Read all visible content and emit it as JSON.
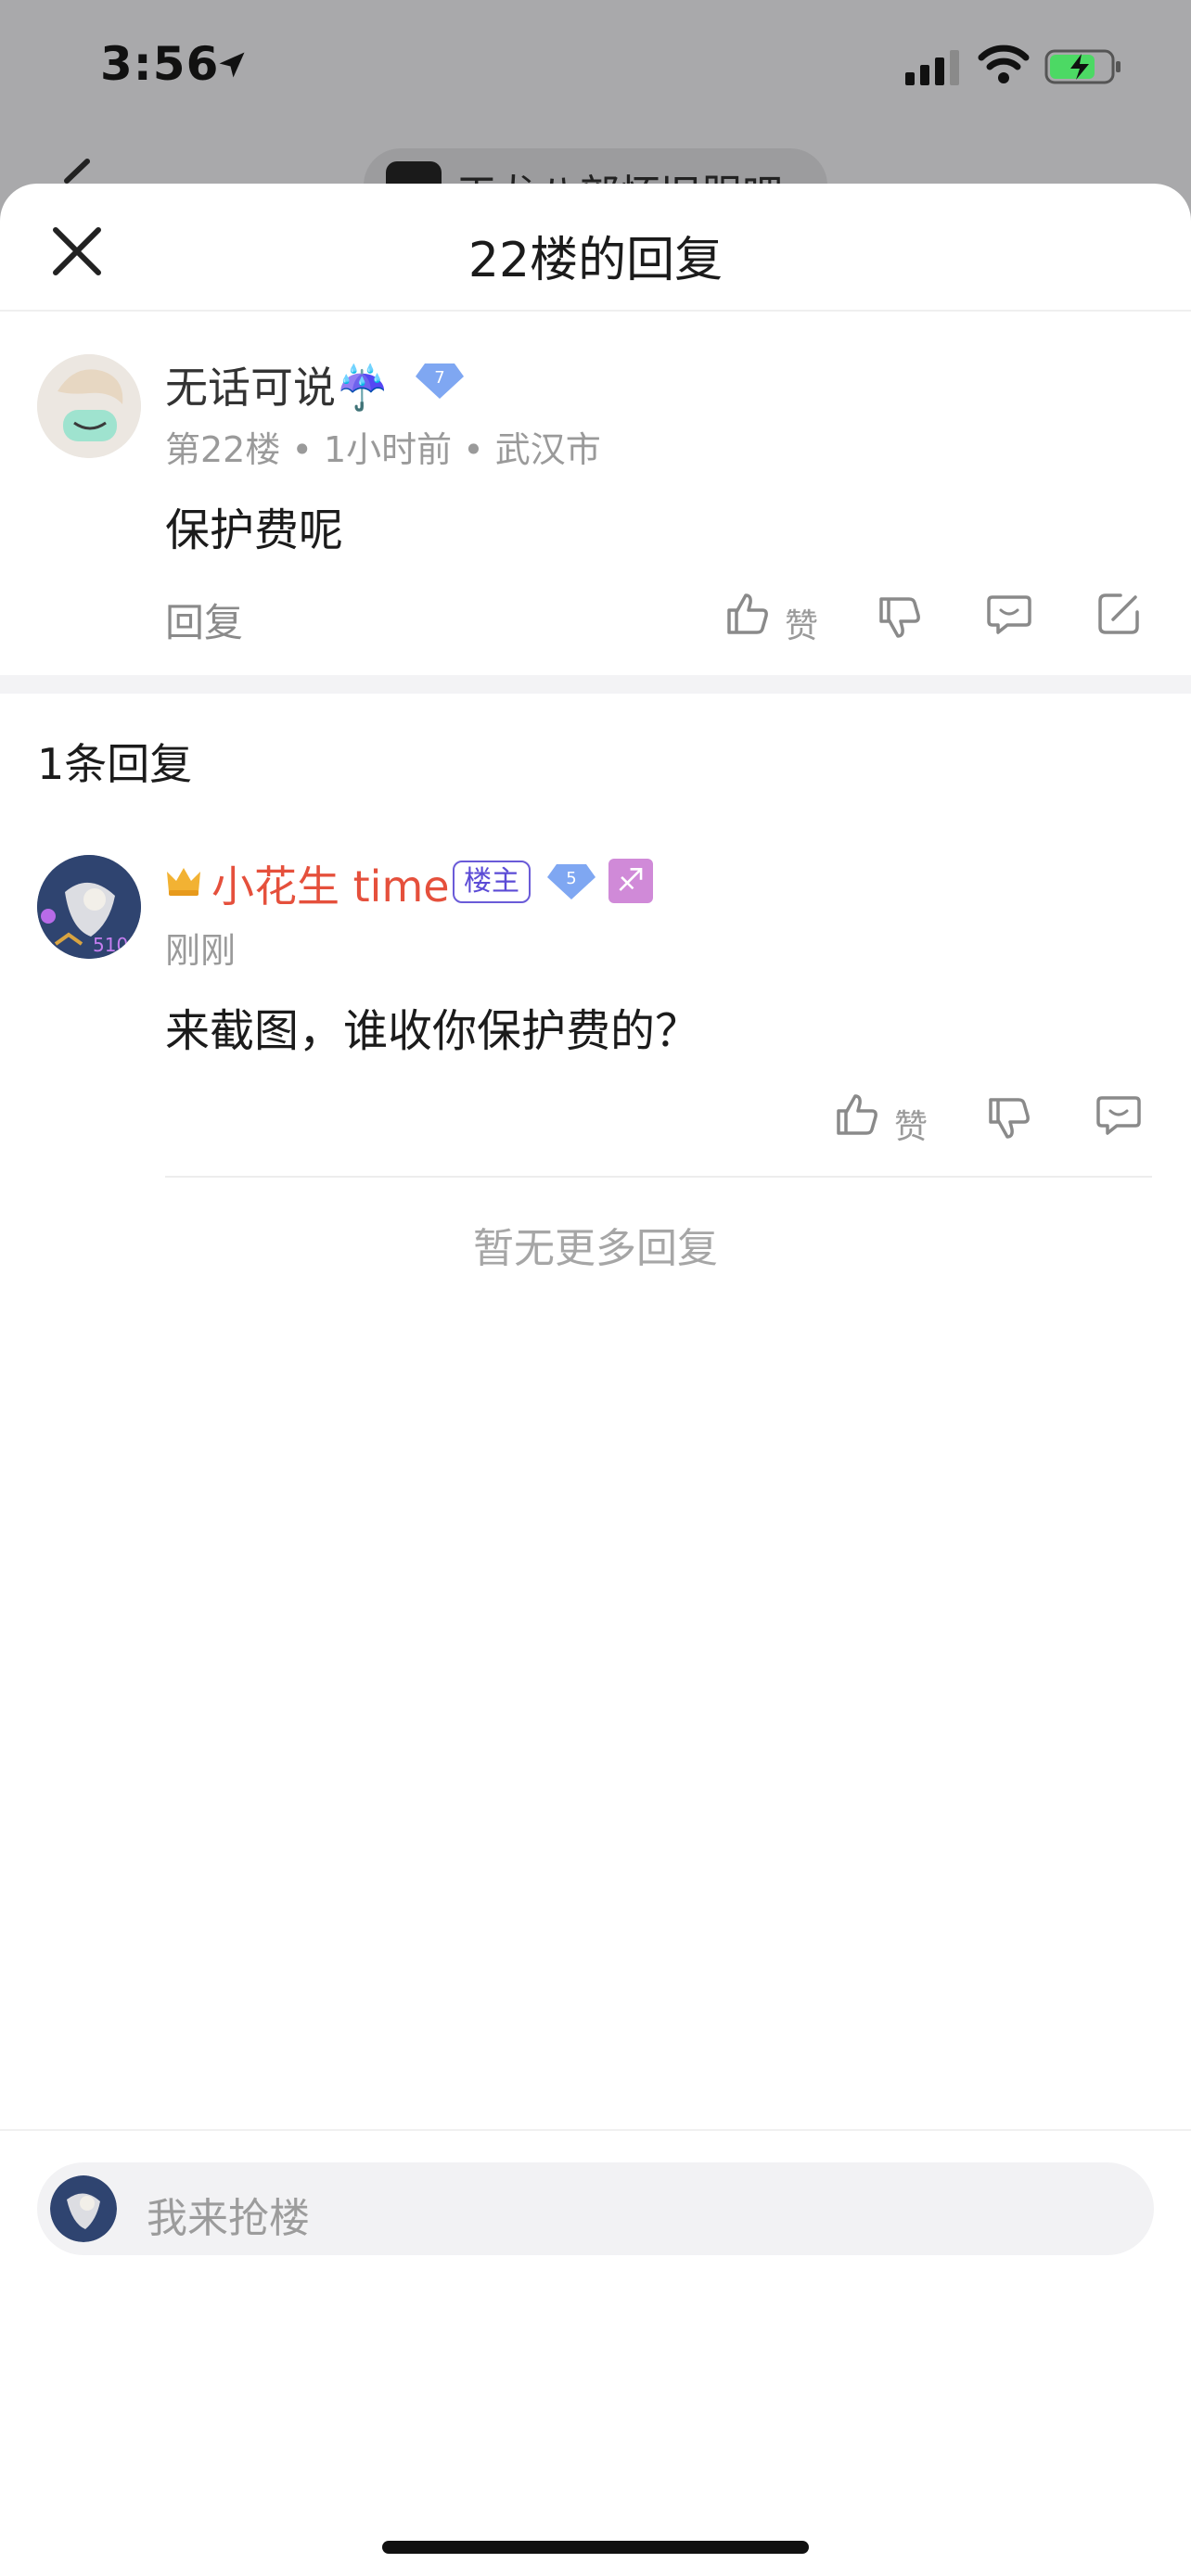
{
  "status": {
    "time": "3:56",
    "icons": [
      "location-arrow-icon",
      "signal-icon",
      "wifi-icon",
      "battery-charging-icon"
    ]
  },
  "background_page": {
    "forum_title": "天龙八部怀旧服吧"
  },
  "sheet": {
    "title": "22楼的回复",
    "close_icon": "close-icon"
  },
  "floor_post": {
    "username": "无话可说☔️",
    "level": "7",
    "floor": "第22楼",
    "time": "1小时前",
    "location": "武汉市",
    "content": "保护费呢",
    "reply_label": "回复",
    "like_label": "赞"
  },
  "replies_section": {
    "count_title": "1条回复",
    "replies": [
      {
        "username": "小花生 time",
        "host_badge": "楼主",
        "level": "5",
        "zodiac_symbol": "♐",
        "time": "刚刚",
        "content": "来截图，谁收你保护费的？",
        "like_label": "赞"
      }
    ],
    "no_more": "暂无更多回复"
  },
  "bottom_bar": {
    "placeholder": "我来抢楼"
  },
  "colors": {
    "host_name": "#e5503c",
    "badge_purple": "#5b4bd6",
    "gem_blue": "#7fa7f2",
    "muted": "#9a9a9a"
  }
}
